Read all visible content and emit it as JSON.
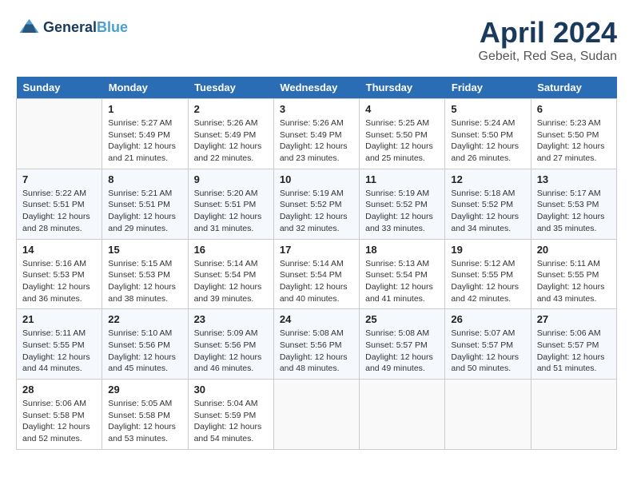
{
  "header": {
    "logo_line1": "General",
    "logo_line2": "Blue",
    "month_title": "April 2024",
    "location": "Gebeit, Red Sea, Sudan"
  },
  "calendar": {
    "days_of_week": [
      "Sunday",
      "Monday",
      "Tuesday",
      "Wednesday",
      "Thursday",
      "Friday",
      "Saturday"
    ],
    "weeks": [
      [
        {
          "day": "",
          "empty": true
        },
        {
          "day": "1",
          "sunrise": "5:27 AM",
          "sunset": "5:49 PM",
          "daylight": "12 hours and 21 minutes."
        },
        {
          "day": "2",
          "sunrise": "5:26 AM",
          "sunset": "5:49 PM",
          "daylight": "12 hours and 22 minutes."
        },
        {
          "day": "3",
          "sunrise": "5:26 AM",
          "sunset": "5:49 PM",
          "daylight": "12 hours and 23 minutes."
        },
        {
          "day": "4",
          "sunrise": "5:25 AM",
          "sunset": "5:50 PM",
          "daylight": "12 hours and 25 minutes."
        },
        {
          "day": "5",
          "sunrise": "5:24 AM",
          "sunset": "5:50 PM",
          "daylight": "12 hours and 26 minutes."
        },
        {
          "day": "6",
          "sunrise": "5:23 AM",
          "sunset": "5:50 PM",
          "daylight": "12 hours and 27 minutes."
        }
      ],
      [
        {
          "day": "7",
          "sunrise": "5:22 AM",
          "sunset": "5:51 PM",
          "daylight": "12 hours and 28 minutes."
        },
        {
          "day": "8",
          "sunrise": "5:21 AM",
          "sunset": "5:51 PM",
          "daylight": "12 hours and 29 minutes."
        },
        {
          "day": "9",
          "sunrise": "5:20 AM",
          "sunset": "5:51 PM",
          "daylight": "12 hours and 31 minutes."
        },
        {
          "day": "10",
          "sunrise": "5:19 AM",
          "sunset": "5:52 PM",
          "daylight": "12 hours and 32 minutes."
        },
        {
          "day": "11",
          "sunrise": "5:19 AM",
          "sunset": "5:52 PM",
          "daylight": "12 hours and 33 minutes."
        },
        {
          "day": "12",
          "sunrise": "5:18 AM",
          "sunset": "5:52 PM",
          "daylight": "12 hours and 34 minutes."
        },
        {
          "day": "13",
          "sunrise": "5:17 AM",
          "sunset": "5:53 PM",
          "daylight": "12 hours and 35 minutes."
        }
      ],
      [
        {
          "day": "14",
          "sunrise": "5:16 AM",
          "sunset": "5:53 PM",
          "daylight": "12 hours and 36 minutes."
        },
        {
          "day": "15",
          "sunrise": "5:15 AM",
          "sunset": "5:53 PM",
          "daylight": "12 hours and 38 minutes."
        },
        {
          "day": "16",
          "sunrise": "5:14 AM",
          "sunset": "5:54 PM",
          "daylight": "12 hours and 39 minutes."
        },
        {
          "day": "17",
          "sunrise": "5:14 AM",
          "sunset": "5:54 PM",
          "daylight": "12 hours and 40 minutes."
        },
        {
          "day": "18",
          "sunrise": "5:13 AM",
          "sunset": "5:54 PM",
          "daylight": "12 hours and 41 minutes."
        },
        {
          "day": "19",
          "sunrise": "5:12 AM",
          "sunset": "5:55 PM",
          "daylight": "12 hours and 42 minutes."
        },
        {
          "day": "20",
          "sunrise": "5:11 AM",
          "sunset": "5:55 PM",
          "daylight": "12 hours and 43 minutes."
        }
      ],
      [
        {
          "day": "21",
          "sunrise": "5:11 AM",
          "sunset": "5:55 PM",
          "daylight": "12 hours and 44 minutes."
        },
        {
          "day": "22",
          "sunrise": "5:10 AM",
          "sunset": "5:56 PM",
          "daylight": "12 hours and 45 minutes."
        },
        {
          "day": "23",
          "sunrise": "5:09 AM",
          "sunset": "5:56 PM",
          "daylight": "12 hours and 46 minutes."
        },
        {
          "day": "24",
          "sunrise": "5:08 AM",
          "sunset": "5:56 PM",
          "daylight": "12 hours and 48 minutes."
        },
        {
          "day": "25",
          "sunrise": "5:08 AM",
          "sunset": "5:57 PM",
          "daylight": "12 hours and 49 minutes."
        },
        {
          "day": "26",
          "sunrise": "5:07 AM",
          "sunset": "5:57 PM",
          "daylight": "12 hours and 50 minutes."
        },
        {
          "day": "27",
          "sunrise": "5:06 AM",
          "sunset": "5:57 PM",
          "daylight": "12 hours and 51 minutes."
        }
      ],
      [
        {
          "day": "28",
          "sunrise": "5:06 AM",
          "sunset": "5:58 PM",
          "daylight": "12 hours and 52 minutes."
        },
        {
          "day": "29",
          "sunrise": "5:05 AM",
          "sunset": "5:58 PM",
          "daylight": "12 hours and 53 minutes."
        },
        {
          "day": "30",
          "sunrise": "5:04 AM",
          "sunset": "5:59 PM",
          "daylight": "12 hours and 54 minutes."
        },
        {
          "day": "",
          "empty": true
        },
        {
          "day": "",
          "empty": true
        },
        {
          "day": "",
          "empty": true
        },
        {
          "day": "",
          "empty": true
        }
      ]
    ]
  }
}
